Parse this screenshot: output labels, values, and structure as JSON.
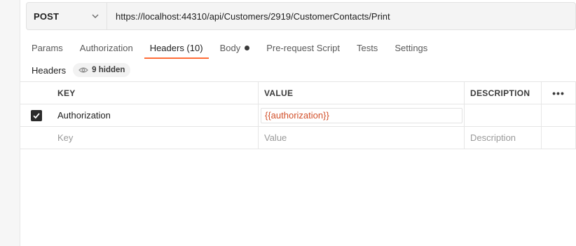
{
  "request": {
    "method": "POST",
    "url": "https://localhost:44310/api/Customers/2919/CustomerContacts/Print"
  },
  "tabs": [
    {
      "label": "Params"
    },
    {
      "label": "Authorization"
    },
    {
      "label": "Headers (10)"
    },
    {
      "label": "Body"
    },
    {
      "label": "Pre-request Script"
    },
    {
      "label": "Tests"
    },
    {
      "label": "Settings"
    }
  ],
  "headers_section": {
    "title": "Headers",
    "hidden_label": "9 hidden"
  },
  "table": {
    "columns": {
      "key": "KEY",
      "value": "VALUE",
      "description": "DESCRIPTION"
    },
    "rows": [
      {
        "checked": true,
        "key": "Authorization",
        "value": "{{authorization}}",
        "description": ""
      }
    ],
    "placeholders": {
      "key": "Key",
      "value": "Value",
      "description": "Description"
    }
  },
  "colors": {
    "accent": "#ff6c37",
    "variable": "#d2502a"
  }
}
